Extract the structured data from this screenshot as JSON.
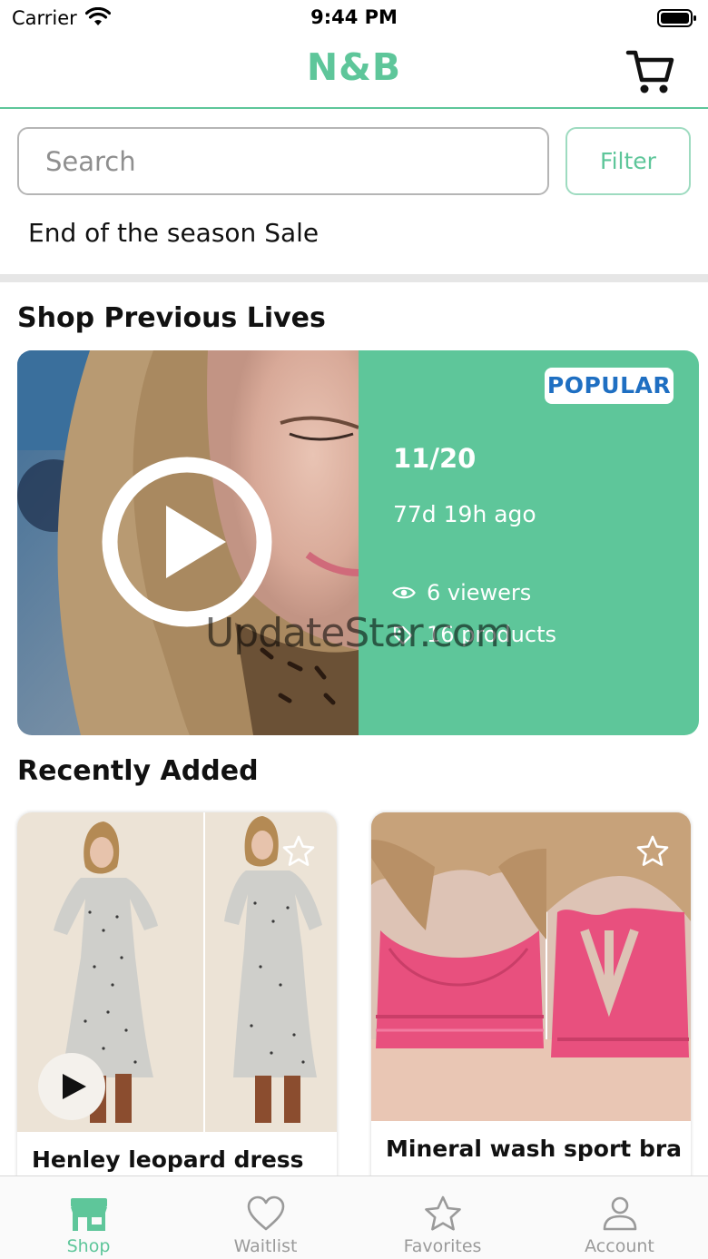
{
  "status_bar": {
    "carrier": "Carrier",
    "time": "9:44 PM",
    "icons": [
      "wifi-icon",
      "battery-icon"
    ]
  },
  "header": {
    "brand": "N&B",
    "cart_icon": "cart-icon"
  },
  "search": {
    "placeholder": "Search",
    "value": "",
    "filter_label": "Filter"
  },
  "sale_link": "End of the season Sale",
  "shop_previous_lives": {
    "title": "Shop Previous Lives",
    "live": {
      "badge": "POPULAR",
      "date": "11/20",
      "ago": "77d 19h ago",
      "viewers": "6 viewers",
      "products": "16 products",
      "icons": [
        "play-icon",
        "eye-icon",
        "tag-icon"
      ]
    }
  },
  "watermark": "UpdateStar.com",
  "recently_added": {
    "title": "Recently Added",
    "products": [
      {
        "name": "Henley leopard dress",
        "has_video": true
      },
      {
        "name": "Mineral wash sport bra",
        "has_video": false
      }
    ]
  },
  "tab_bar": {
    "tabs": [
      {
        "label": "Shop",
        "icon": "shop-icon",
        "active": true
      },
      {
        "label": "Waitlist",
        "icon": "heart-icon",
        "active": false
      },
      {
        "label": "Favorites",
        "icon": "star-icon",
        "active": false
      },
      {
        "label": "Account",
        "icon": "account-icon",
        "active": false
      }
    ]
  },
  "colors": {
    "accent": "#5ec69a",
    "badge_text": "#1f6fc2",
    "product_pink": "#e8507e"
  }
}
